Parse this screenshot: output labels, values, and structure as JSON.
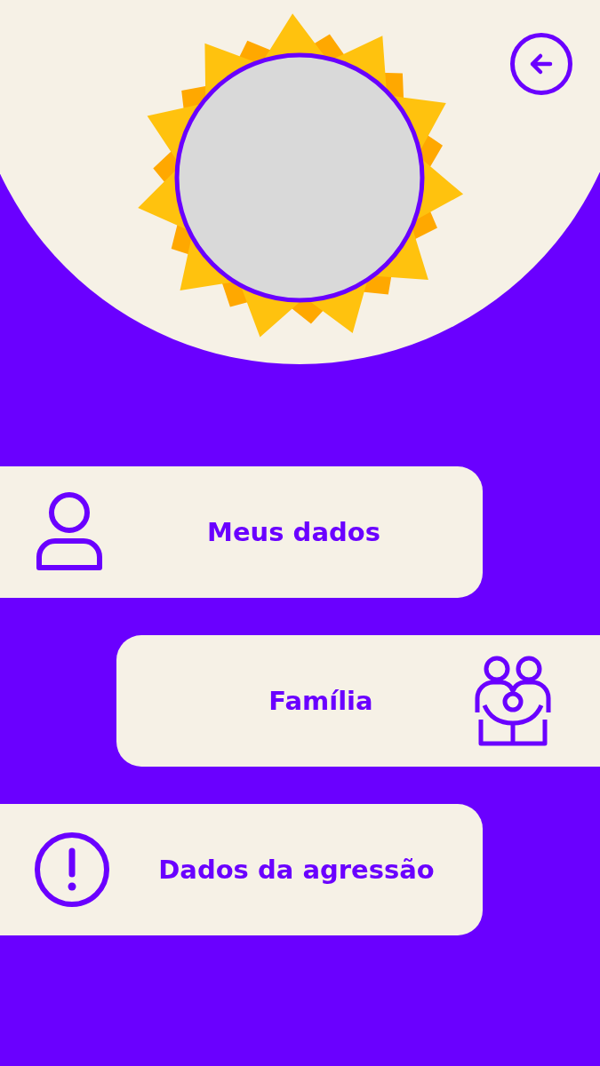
{
  "menu": [
    {
      "label": "Meus dados",
      "kind": "person",
      "right_aligned": false
    },
    {
      "label": "Família",
      "kind": "family",
      "right_aligned": true
    },
    {
      "label": "Dados da agressão",
      "kind": "alert",
      "right_aligned": false
    }
  ]
}
